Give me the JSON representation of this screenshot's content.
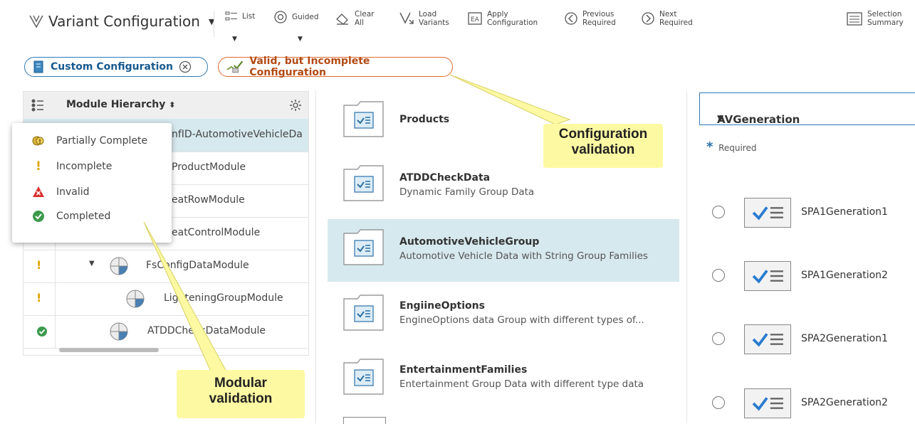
{
  "toolbar": {
    "title": "Variant Configuration",
    "buttons": [
      {
        "id": "list",
        "line1": "List",
        "line2": ""
      },
      {
        "id": "guided",
        "line1": "Guided",
        "line2": ""
      },
      {
        "id": "clear",
        "line1": "Clear",
        "line2": "All"
      },
      {
        "id": "load",
        "line1": "Load",
        "line2": "Variants"
      },
      {
        "id": "apply",
        "line1": "Apply",
        "line2": "Configuration"
      },
      {
        "id": "prev",
        "line1": "Previous",
        "line2": "Required"
      },
      {
        "id": "next",
        "line1": "Next",
        "line2": "Required"
      },
      {
        "id": "summary",
        "line1": "Selection",
        "line2": "Summary"
      }
    ]
  },
  "chips": {
    "custom": "Custom Configuration",
    "valid": "Valid, but Incomplete Configuration"
  },
  "hierarchy": {
    "header": "Module Hierarchy",
    "rows": [
      {
        "label": "nfID-AutomotiveVehicleDa",
        "status": "none"
      },
      {
        "label": "ProductModule",
        "status": "none"
      },
      {
        "label": "eatRowModule",
        "status": "none"
      },
      {
        "label": "eatControlModule",
        "status": "none"
      },
      {
        "label": "FsConfigDataModule",
        "status": "incomplete"
      },
      {
        "label": "LighteningGroupModule",
        "status": "incomplete"
      },
      {
        "label": "ATDDCheckDataModule",
        "status": "completed"
      }
    ]
  },
  "legend": {
    "items": [
      {
        "label": "Partially Complete",
        "icon": "partial-icon"
      },
      {
        "label": "Incomplete",
        "icon": "incomplete-icon"
      },
      {
        "label": "Invalid",
        "icon": "invalid-icon"
      },
      {
        "label": "Completed",
        "icon": "completed-icon"
      }
    ]
  },
  "families": [
    {
      "name": "Products",
      "desc": ""
    },
    {
      "name": "ATDDCheckData",
      "desc": "Dynamic Family Group Data"
    },
    {
      "name": "AutomotiveVehicleGroup",
      "desc": "Automotive Vehicle Data with String Group Families"
    },
    {
      "name": "EngiineOptions",
      "desc": "EngineOptions data Group with different types of..."
    },
    {
      "name": "EntertainmentFamilies",
      "desc": "Entertainment Group Data with different type data"
    }
  ],
  "right": {
    "group": "AVGeneration",
    "required": "Required",
    "options": [
      "SPA1Generation1",
      "SPA1Generation2",
      "SPA2Generation1",
      "SPA2Generation2"
    ]
  },
  "annotations": {
    "config": [
      "Configuration",
      "validation"
    ],
    "modular": [
      "Modular",
      "validation"
    ]
  },
  "colors": {
    "selected_row": "#d6e9ee",
    "accent": "#2a7bb7",
    "warning": "#e06a2b",
    "note_bg": "#fdf9a3"
  }
}
